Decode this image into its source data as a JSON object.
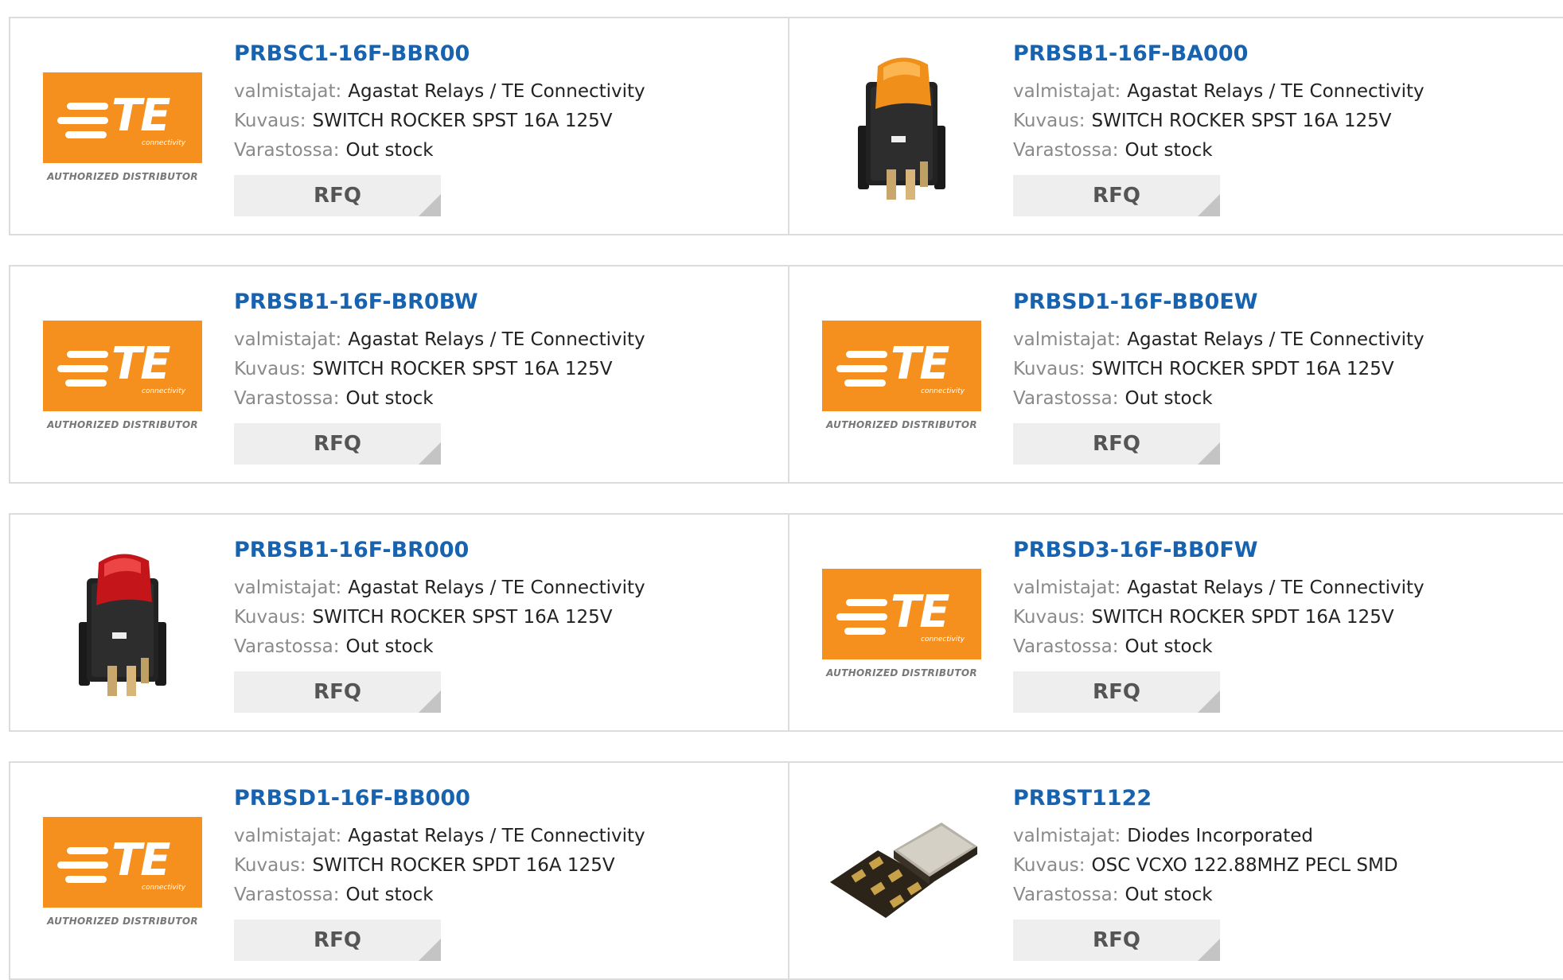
{
  "labels": {
    "manufacturer": "valmistajat:",
    "description": "Kuvaus:",
    "stock": "Varastossa:",
    "rfq": "RFQ",
    "logo_text": "TE",
    "logo_sub": "connectivity",
    "logo_distributor": "AUTHORIZED DISTRIBUTOR"
  },
  "colors": {
    "part_link": "#1763b0",
    "te_orange": "#f5901e"
  },
  "products": [
    {
      "part": "PRBSC1-16F-BBR00",
      "manufacturer": "Agastat Relays / TE Connectivity",
      "description": "SWITCH ROCKER SPST 16A 125V",
      "stock": "Out stock",
      "image": "te-logo"
    },
    {
      "part": "PRBSB1-16F-BA000",
      "manufacturer": "Agastat Relays / TE Connectivity",
      "description": "SWITCH ROCKER SPST 16A 125V",
      "stock": "Out stock",
      "image": "rocker-switch-amber"
    },
    {
      "part": "PRBSB1-16F-BR0BW",
      "manufacturer": "Agastat Relays / TE Connectivity",
      "description": "SWITCH ROCKER SPST 16A 125V",
      "stock": "Out stock",
      "image": "te-logo"
    },
    {
      "part": "PRBSD1-16F-BB0EW",
      "manufacturer": "Agastat Relays / TE Connectivity",
      "description": "SWITCH ROCKER SPDT 16A 125V",
      "stock": "Out stock",
      "image": "te-logo"
    },
    {
      "part": "PRBSB1-16F-BR000",
      "manufacturer": "Agastat Relays / TE Connectivity",
      "description": "SWITCH ROCKER SPST 16A 125V",
      "stock": "Out stock",
      "image": "rocker-switch-red"
    },
    {
      "part": "PRBSD3-16F-BB0FW",
      "manufacturer": "Agastat Relays / TE Connectivity",
      "description": "SWITCH ROCKER SPDT 16A 125V",
      "stock": "Out stock",
      "image": "te-logo"
    },
    {
      "part": "PRBSD1-16F-BB000",
      "manufacturer": "Agastat Relays / TE Connectivity",
      "description": "SWITCH ROCKER SPDT 16A 125V",
      "stock": "Out stock",
      "image": "te-logo"
    },
    {
      "part": "PRBST1122",
      "manufacturer": "Diodes Incorporated",
      "description": "OSC VCXO 122.88MHZ PECL SMD",
      "stock": "Out stock",
      "image": "smd-oscillator"
    }
  ]
}
